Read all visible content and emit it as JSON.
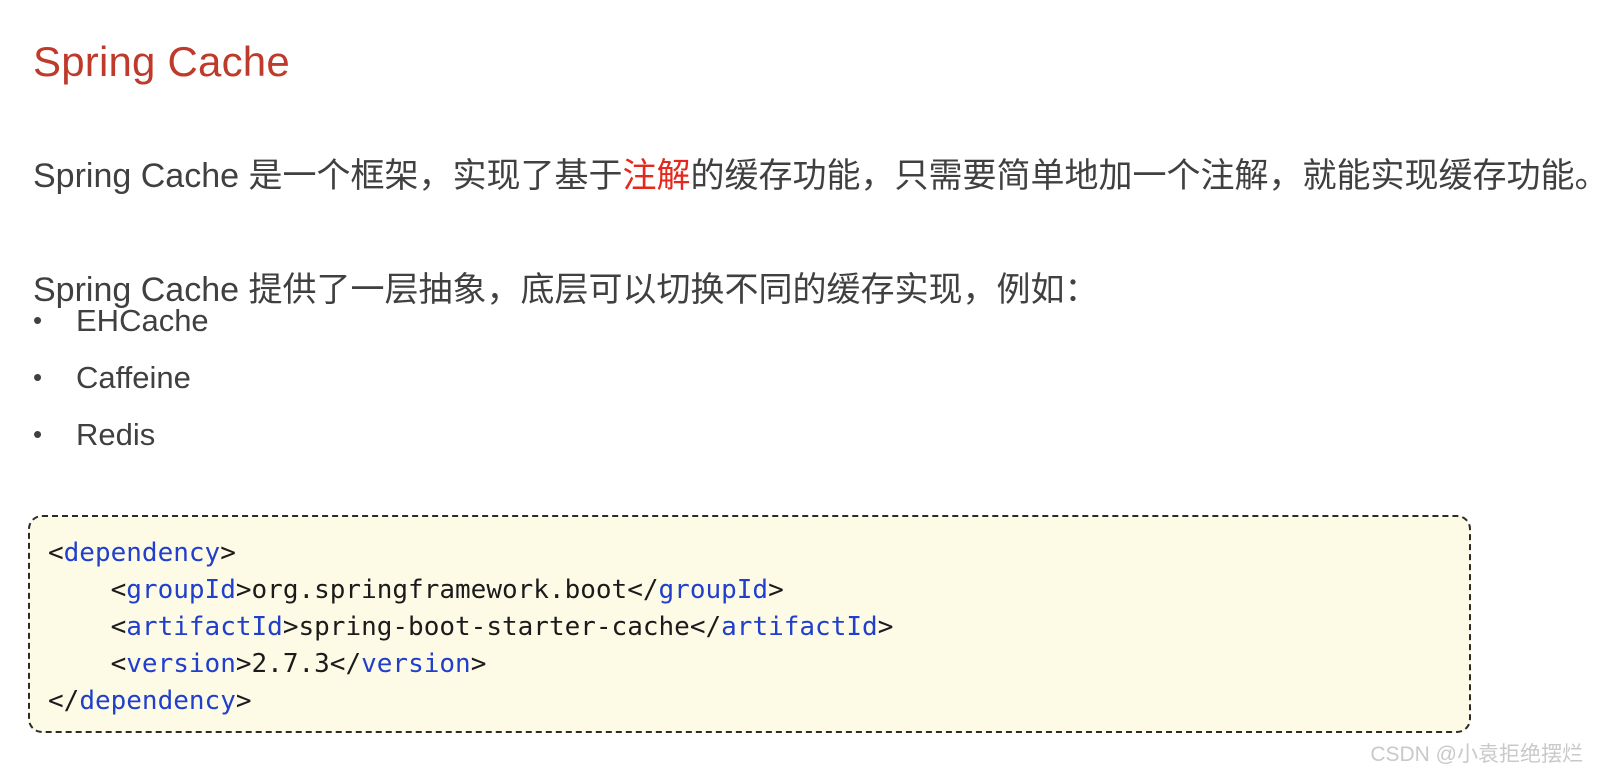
{
  "slide": {
    "title": "Spring Cache",
    "title_color": "#be3b2b",
    "background_color": "#ffffff",
    "body_text_color": "#404040"
  },
  "paragraphs": {
    "p1": {
      "before_highlight": "Spring Cache 是一个框架，实现了基于",
      "highlight": "注解",
      "highlight_color": "#e5281c",
      "after_highlight": "的缓存功能，只需要简单地加一个注解，就能实现缓存功能。"
    },
    "p2": {
      "text": "Spring Cache 提供了一层抽象，底层可以切换不同的缓存实现，例如："
    }
  },
  "bullet_list": {
    "marker": "•",
    "items": [
      {
        "label": "EHCache"
      },
      {
        "label": "Caffeine"
      },
      {
        "label": "Redis"
      }
    ]
  },
  "code_block": {
    "language": "xml",
    "background_color": "#fdfae6",
    "border_color": "#2b2b2b",
    "tag_color": "#1f3fcc",
    "text_color": "#1b1b1b",
    "lines": [
      {
        "indent": "",
        "open_lt": "<",
        "open_tag": "dependency",
        "open_gt": ">",
        "content": "",
        "close_lt": "",
        "close_tag": "",
        "close_gt": ""
      },
      {
        "indent": "    ",
        "open_lt": "<",
        "open_tag": "groupId",
        "open_gt": ">",
        "content": "org.springframework.boot",
        "close_lt": "</",
        "close_tag": "groupId",
        "close_gt": ">"
      },
      {
        "indent": "    ",
        "open_lt": "<",
        "open_tag": "artifactId",
        "open_gt": ">",
        "content": "spring-boot-starter-cache",
        "close_lt": "</",
        "close_tag": "artifactId",
        "close_gt": ">"
      },
      {
        "indent": "    ",
        "open_lt": "<",
        "open_tag": "version",
        "open_gt": ">",
        "content": "2.7.3",
        "close_lt": "</",
        "close_tag": "version",
        "close_gt": ">"
      },
      {
        "indent": "",
        "open_lt": "</",
        "open_tag": "dependency",
        "open_gt": ">",
        "content": "",
        "close_lt": "",
        "close_tag": "",
        "close_gt": ""
      }
    ]
  },
  "watermark": {
    "text": "CSDN @小袁拒绝摆烂",
    "color": "#c9c9c9"
  }
}
